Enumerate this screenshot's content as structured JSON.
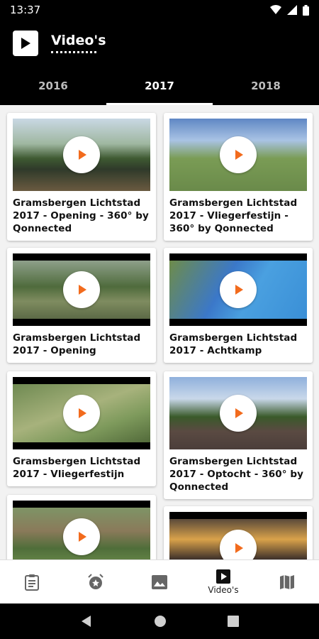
{
  "status": {
    "time": "13:37"
  },
  "header": {
    "title": "Video's"
  },
  "tabs": [
    {
      "label": "2016",
      "active": false
    },
    {
      "label": "2017",
      "active": true
    },
    {
      "label": "2018",
      "active": false
    }
  ],
  "videos": [
    {
      "title": "Gramsbergen Lichtstad 2017 - Opening - 360° by Qonnected"
    },
    {
      "title": "Gramsbergen Lichtstad 2017 - Vliegerfestijn - 360° by Qonnected"
    },
    {
      "title": "Gramsbergen Lichtstad 2017 - Opening"
    },
    {
      "title": "Gramsbergen Lichtstad 2017 - Achtkamp"
    },
    {
      "title": "Gramsbergen Lichtstad 2017 - Vliegerfestijn"
    },
    {
      "title": "Gramsbergen Lichtstad 2017 - Optocht - 360° by Qonnected"
    },
    {
      "title": ""
    },
    {
      "title": ""
    }
  ],
  "bottom_nav": [
    {
      "icon": "clipboard-icon",
      "label": ""
    },
    {
      "icon": "alarm-star-icon",
      "label": ""
    },
    {
      "icon": "image-icon",
      "label": ""
    },
    {
      "icon": "video-icon",
      "label": "Video's"
    },
    {
      "icon": "map-icon",
      "label": ""
    }
  ],
  "colors": {
    "accent": "#f26b1d",
    "bar": "#000000",
    "background": "#f2f2f2"
  }
}
